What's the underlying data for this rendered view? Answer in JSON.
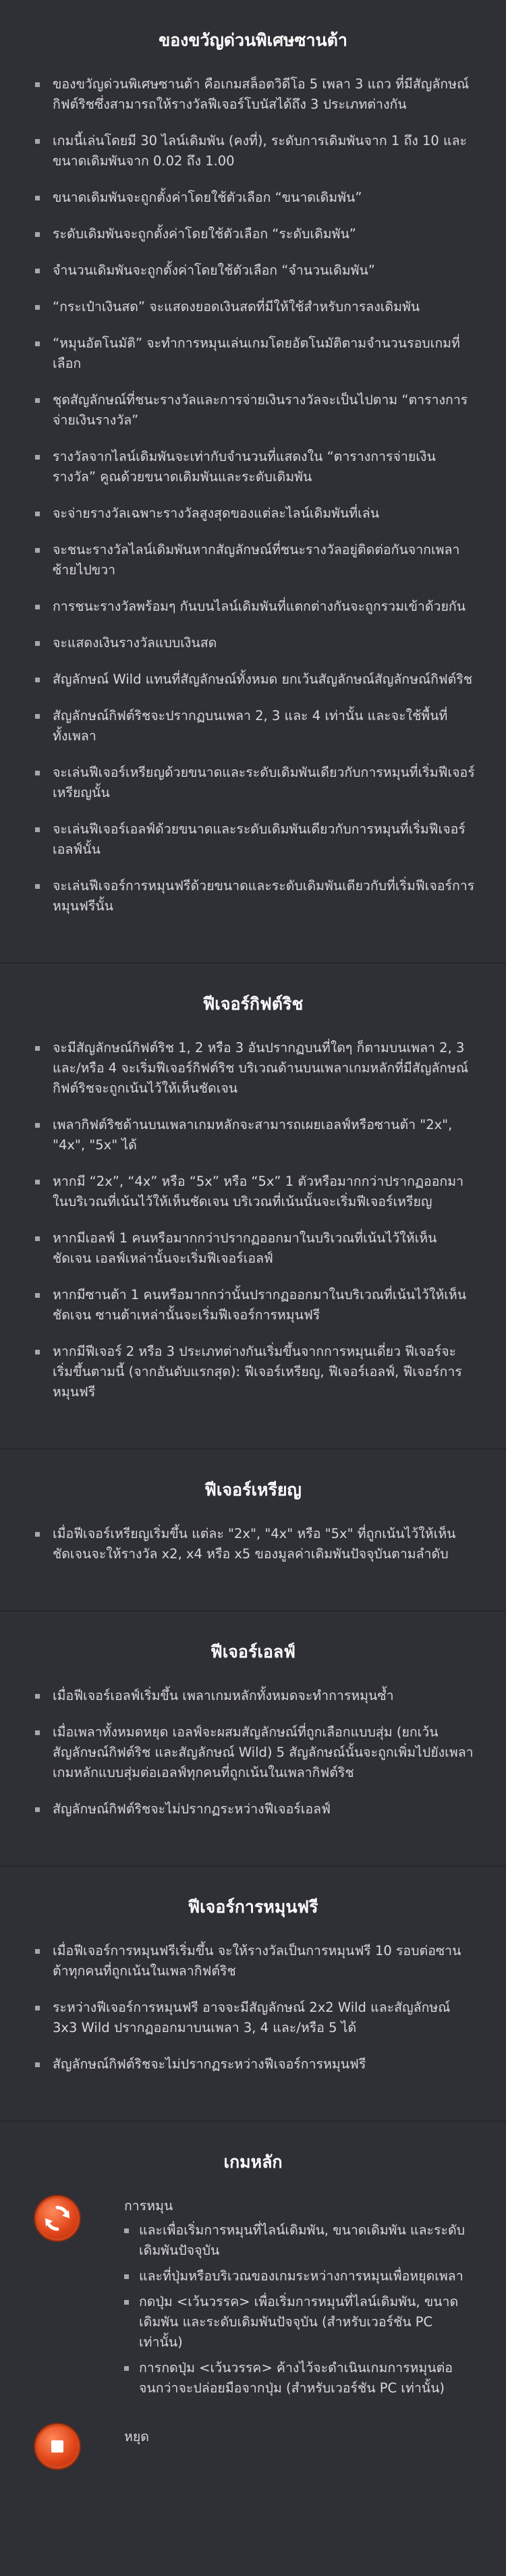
{
  "sections": [
    {
      "title": "ของขวัญด่วนพิเศษซานต้า",
      "items": [
        "ของขวัญด่วนพิเศษซานต้า คือเกมสล็อตวิดีโอ 5 เพลา 3 แถว ที่มีสัญลักษณ์กิฟต์ริชซึ่งสามารถให้รางวัลฟีเจอร์โบนัสได้ถึง 3 ประเภทต่างกัน",
        "เกมนี้เล่นโดยมี 30 ไลน์เดิมพัน (คงที่), ระดับการเดิมพันจาก 1 ถึง 10 และขนาดเดิมพันจาก 0.02 ถึง 1.00",
        "ขนาดเดิมพันจะถูกตั้งค่าโดยใช้ตัวเลือก “ขนาดเดิมพัน”",
        "ระดับเดิมพันจะถูกตั้งค่าโดยใช้ตัวเลือก “ระดับเดิมพัน”",
        "จำนวนเดิมพันจะถูกตั้งค่าโดยใช้ตัวเลือก “จำนวนเดิมพัน”",
        "“กระเป๋าเงินสด” จะแสดงยอดเงินสดที่มีให้ใช้สำหรับการลงเดิมพัน",
        "“หมุนอัตโนมัติ” จะทำการหมุนเล่นเกมโดยอัตโนมัติตามจำนวนรอบเกมที่เลือก",
        "ชุดสัญลักษณ์ที่ชนะรางวัลและการจ่ายเงินรางวัลจะเป็นไปตาม “ตารางการจ่ายเงินรางวัล”",
        "รางวัลจากไลน์เดิมพันจะเท่ากับจำนวนที่แสดงใน “ตารางการจ่ายเงินรางวัล” คูณด้วยขนาดเดิมพันและระดับเดิมพัน",
        "จะจ่ายรางวัลเฉพาะรางวัลสูงสุดของแต่ละไลน์เดิมพันที่เล่น",
        "จะชนะรางวัลไลน์เดิมพันหากสัญลักษณ์ที่ชนะรางวัลอยู่ติดต่อกันจากเพลาซ้ายไปขวา",
        "การชนะรางวัลพร้อมๆ กันบนไลน์เดิมพันที่แตกต่างกันจะถูกรวมเข้าด้วยกัน",
        "จะแสดงเงินรางวัลแบบเงินสด",
        "สัญลักษณ์ Wild แทนที่สัญลักษณ์ทั้งหมด ยกเว้นสัญลักษณ์สัญลักษณ์กิฟต์ริช",
        "สัญลักษณ์กิฟต์ริชจะปรากฏบนเพลา 2, 3 และ 4 เท่านั้น และจะใช้พื้นที่ทั้งเพลา",
        "จะเล่นฟีเจอร์เหรียญด้วยขนาดและระดับเดิมพันเดียวกับการหมุนที่เริ่มฟีเจอร์เหรียญนั้น",
        "จะเล่นฟีเจอร์เอลฟ์ด้วยขนาดและระดับเดิมพันเดียวกับการหมุนที่เริ่มฟีเจอร์เอลฟ์นั้น",
        "จะเล่นฟีเจอร์การหมุนฟรีด้วยขนาดและระดับเดิมพันเดียวกับที่เริ่มฟีเจอร์การหมุนฟรีนั้น"
      ]
    },
    {
      "title": "ฟีเจอร์กิฟต์ริช",
      "items": [
        "จะมีสัญลักษณ์กิฟต์ริช 1, 2 หรือ 3 อันปรากฏบนที่ใดๆ ก็ตามบนเพลา 2, 3 และ/หรือ 4 จะเริ่มฟีเจอร์กิฟต์ริช บริเวณด้านบนเพลาเกมหลักที่มีสัญลักษณ์กิฟต์ริชจะถูกเน้นไว้ให้เห็นชัดเจน",
        "เพลากิฟต์ริชด้านบนเพลาเกมหลักจะสามารถเผยเอลฟ์หรือซานต้า \"2x\", \"4x\", \"5x\" ได้",
        "หากมี “2x”, “4x” หรือ “5x” หรือ “5x” 1 ตัวหรือมากกว่าปรากฏออกมาในบริเวณที่เน้นไว้ให้เห็นชัดเจน บริเวณที่เน้นนั้นจะเริ่มฟีเจอร์เหรียญ",
        "หากมีเอลฟ์ 1 คนหรือมากกว่าปรากฏออกมาในบริเวณที่เน้นไว้ให้เห็นชัดเจน เอลฟ์เหล่านั้นจะเริ่มฟีเจอร์เอลฟ์",
        "หากมีซานต้า 1 คนหรือมากกว่านั้นปรากฏออกมาในบริเวณที่เน้นไว้ให้เห็นชัดเจน ซานต้าเหล่านั้นจะเริ่มฟีเจอร์การหมุนฟรี",
        "หากมีฟีเจอร์ 2 หรือ 3 ประเภทต่างกันเริ่มขึ้นจากการหมุนเดี่ยว ฟีเจอร์จะเริ่มขึ้นตามนี้ (จากอันดับแรกสุด): ฟีเจอร์เหรียญ, ฟีเจอร์เอลฟ์, ฟีเจอร์การหมุนฟรี"
      ]
    },
    {
      "title": "ฟีเจอร์เหรียญ",
      "items": [
        "เมื่อฟีเจอร์เหรียญเริ่มขึ้น แต่ละ \"2x\", \"4x\" หรือ \"5x\" ที่ถูกเน้นไว้ให้เห็นชัดเจนจะให้รางวัล x2, x4 หรือ x5 ของมูลค่าเดิมพันปัจจุบันตามลำดับ"
      ]
    },
    {
      "title": "ฟีเจอร์เอลฟ์",
      "items": [
        "เมื่อฟีเจอร์เอลฟ์เริ่มขึ้น เพลาเกมหลักทั้งหมดจะทำการหมุนซ้ำ",
        "เมื่อเพลาทั้งหมดหยุด เอลฟ์จะผสมสัญลักษณ์ที่ถูกเลือกแบบสุ่ม (ยกเว้นสัญลักษณ์กิฟต์ริช และสัญลักษณ์ Wild) 5 สัญลักษณ์นั้นจะถูกเพิ่มไปยังเพลาเกมหลักแบบสุ่มต่อเอลฟ์ทุกคนที่ถูกเน้นในเพลากิฟต์ริช",
        "สัญลักษณ์กิฟต์ริชจะไม่ปรากฏระหว่างฟีเจอร์เอลฟ์"
      ]
    },
    {
      "title": "ฟีเจอร์การหมุนฟรี",
      "items": [
        "เมื่อฟีเจอร์การหมุนฟรีเริ่มขึ้น จะให้รางวัลเป็นการหมุนฟรี 10 รอบต่อซานต้าทุกคนที่ถูกเน้นในเพลากิฟต์ริช",
        "ระหว่างฟีเจอร์การหมุนฟรี อาจจะมีสัญลักษณ์ 2x2 Wild และสัญลักษณ์ 3x3 Wild ปรากฏออกมาบนเพลา 3, 4 และ/หรือ 5 ได้",
        "สัญลักษณ์กิฟต์ริชจะไม่ปรากฏระหว่างฟีเจอร์การหมุนฟรี"
      ]
    }
  ],
  "game_section": {
    "title": "เกมหลัก",
    "blocks": [
      {
        "icon": "spin-refresh-icon",
        "title": "การหมุน",
        "items": [
          "และเพื่อเริ่มการหมุนที่ไลน์เดิมพัน, ขนาดเดิมพัน และระดับเดิมพันปัจจุบัน",
          "และที่ปุ่มหรือบริเวณของเกมระหว่างการหมุนเพื่อหยุดเพลา",
          "กดปุ่ม <เว้นวรรค> เพื่อเริ่มการหมุนที่ไลน์เดิมพัน, ขนาดเดิมพัน และระดับเดิมพันปัจจุบัน (สำหรับเวอร์ชัน PC เท่านั้น)",
          "การกดปุ่ม <เว้นวรรค> ค้างไว้จะดำเนินเกมการหมุนต่อจนกว่าจะปล่อยมือจากปุ่ม (สำหรับเวอร์ชัน PC เท่านั้น)"
        ]
      },
      {
        "icon": "stop-icon",
        "title": "หยุด",
        "items": []
      }
    ]
  }
}
